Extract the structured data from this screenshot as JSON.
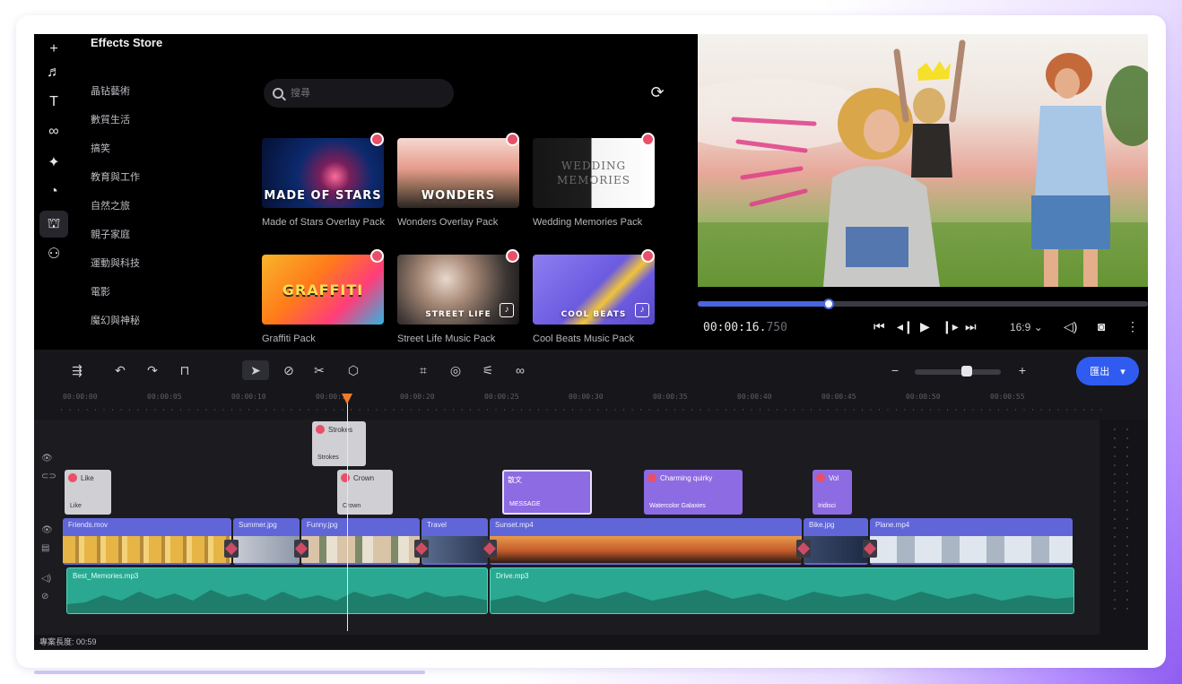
{
  "rail": {
    "icons": [
      "plus-icon",
      "music-icon",
      "text-icon",
      "infinity-icon",
      "sparkle-icon",
      "sticker-icon",
      "store-icon",
      "effects-icon"
    ]
  },
  "store": {
    "title": "Effects Store",
    "categories": [
      "晶钻藝術",
      "數質生活",
      "搞笑",
      "教育與工作",
      "自然之旅",
      "親子家庭",
      "運動與科技",
      "電影",
      "魔幻與神秘"
    ],
    "search_placeholder": "搜尋",
    "items": [
      {
        "thumb_title": "MADE OF STARS",
        "name": "Made of Stars Overlay Pack",
        "music": false
      },
      {
        "thumb_title": "WONDERS",
        "name": "Wonders Overlay Pack",
        "music": false
      },
      {
        "thumb_title": "WEDDING MEMORIES",
        "name": "Wedding Memories Pack",
        "music": false
      },
      {
        "thumb_title": "GRAFFITI",
        "name": "Graffiti Pack",
        "music": false
      },
      {
        "thumb_title": "STREET LIFE",
        "name": "Street Life Music Pack",
        "music": true
      },
      {
        "thumb_title": "COOL BEATS",
        "name": "Cool Beats Music Pack",
        "music": true
      }
    ]
  },
  "preview": {
    "timecode_main": "00:00:16.",
    "timecode_frac": "750",
    "progress": 0.29,
    "ratio": "16:9"
  },
  "toolbar": {
    "export_label": "匯出"
  },
  "ruler": {
    "ticks": [
      "00:00:00",
      "00:00:05",
      "00:00:10",
      "00:00:15",
      "00:00:20",
      "00:00:25",
      "00:00:30",
      "00:00:35",
      "00:00:40",
      "00:00:45",
      "00:00:50",
      "00:00:55"
    ]
  },
  "timeline": {
    "stickers": [
      {
        "title": "Strokes",
        "sub": "Strokes"
      },
      {
        "title": "Like",
        "sub": "Like"
      },
      {
        "title": "Crown",
        "sub": "Crown"
      }
    ],
    "texts": [
      {
        "title": "散文",
        "sub": "MESSAGE"
      },
      {
        "title": "Charming quirky",
        "sub": "Watercolor Galaxies"
      },
      {
        "title": "Vol",
        "sub": "Iridisci"
      }
    ],
    "video_clips": [
      "Friends.mov",
      "Summer.jpg",
      "Funny.jpg",
      "Travel",
      "Sunset.mp4",
      "Bike.jpg",
      "Plane.mp4"
    ],
    "audio_clips": [
      "Best_Memories.mp3",
      "Drive.mp3"
    ]
  },
  "footer": {
    "duration": "專案長度: 00:59"
  },
  "colors": {
    "accent": "#2f5bf0",
    "video_clip": "#6066d8",
    "audio_clip": "#2aa891",
    "text_clip": "#8d6be2",
    "playhead": "#f07a2a"
  }
}
